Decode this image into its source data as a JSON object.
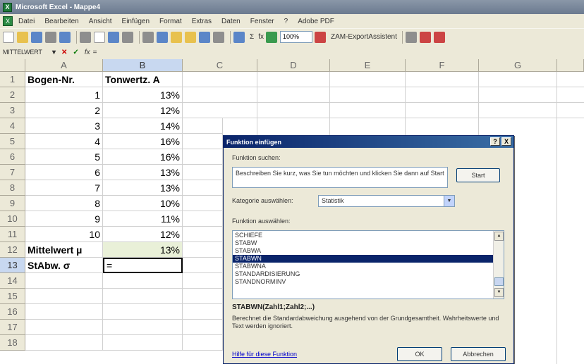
{
  "window": {
    "title": "Microsoft Excel - Mappe4",
    "icon": "X"
  },
  "menu": [
    "Datei",
    "Bearbeiten",
    "Ansicht",
    "Einfügen",
    "Format",
    "Extras",
    "Daten",
    "Fenster",
    "?",
    "Adobe PDF"
  ],
  "toolbar": {
    "zoom": "100%",
    "assistant": "ZAM-ExportAssistent"
  },
  "formula_bar": {
    "name_box": "MITTELWERT",
    "cancel": "✕",
    "enter": "✓",
    "fx": "fx",
    "content": "="
  },
  "grid": {
    "columns": [
      "A",
      "B",
      "C",
      "D",
      "E",
      "F",
      "G"
    ],
    "rows": [
      "1",
      "2",
      "3",
      "4",
      "5",
      "6",
      "7",
      "8",
      "9",
      "10",
      "11",
      "12",
      "13",
      "14",
      "15",
      "16",
      "17",
      "18"
    ],
    "col_a": [
      "Bogen-Nr.",
      "1",
      "2",
      "3",
      "4",
      "5",
      "6",
      "7",
      "8",
      "9",
      "10",
      "Mittelwert µ",
      "StAbw. σ"
    ],
    "col_b": [
      "Tonwertz. A",
      "13%",
      "12%",
      "14%",
      "16%",
      "16%",
      "13%",
      "13%",
      "10%",
      "11%",
      "12%",
      "13%",
      "="
    ]
  },
  "dialog": {
    "title": "Funktion einfügen",
    "help_btn": "?",
    "close_btn": "X",
    "search_label": "Funktion suchen:",
    "search_text": "Beschreiben Sie kurz, was Sie tun möchten und klicken Sie dann auf Start",
    "start_button": "Start",
    "category_label": "Kategorie auswählen:",
    "category_value": "Statistik",
    "function_label": "Funktion auswählen:",
    "functions": [
      "SCHIEFE",
      "STABW",
      "STABWA",
      "STABWN",
      "STABWNA",
      "STANDARDISIERUNG",
      "STANDNORMINV"
    ],
    "selected_function_index": 3,
    "signature": "STABWN(Zahl1;Zahl2;...)",
    "description": "Berechnet die Standardabweichung ausgehend von der Grundgesamtheit. Wahrheitswerte und Text werden ignoriert.",
    "help_link": "Hilfe für diese Funktion",
    "ok_button": "OK",
    "cancel_button": "Abbrechen"
  },
  "colors": {
    "selection": "#0a246a",
    "highlight_cell": "#e9f0d8",
    "title_bar": "#0a246a"
  }
}
